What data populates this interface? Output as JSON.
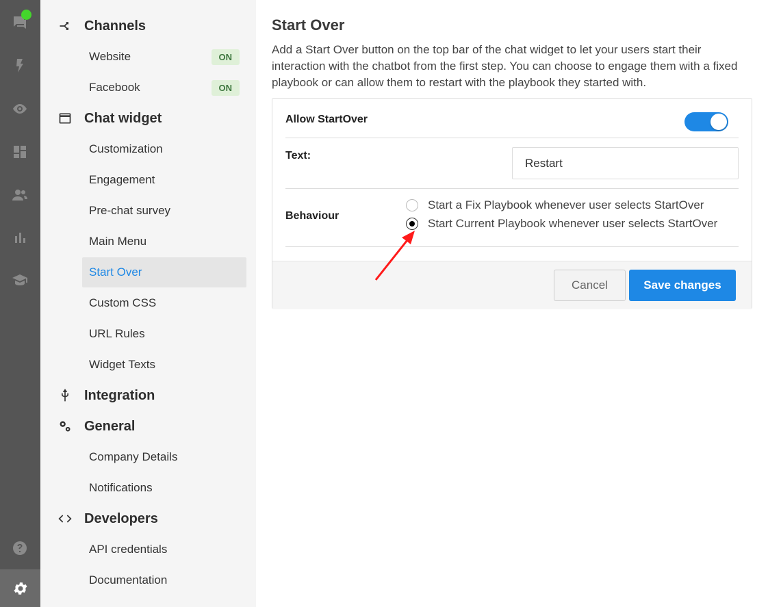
{
  "rail": {
    "icons": [
      "chat-icon",
      "bolt-icon",
      "eye-icon",
      "dashboard-icon",
      "users-icon",
      "bar-chart-icon",
      "graduation-icon",
      "help-icon",
      "gear-icon"
    ],
    "notification_color": "#44d62c"
  },
  "nav": {
    "channels": {
      "title": "Channels",
      "items": [
        {
          "label": "Website",
          "badge": "ON"
        },
        {
          "label": "Facebook",
          "badge": "ON"
        }
      ]
    },
    "chat_widget": {
      "title": "Chat widget",
      "items": [
        "Customization",
        "Engagement",
        "Pre-chat survey",
        "Main Menu",
        "Start Over",
        "Custom CSS",
        "URL Rules",
        "Widget Texts"
      ],
      "active": "Start Over"
    },
    "integration": {
      "title": "Integration"
    },
    "general": {
      "title": "General",
      "items": [
        "Company Details",
        "Notifications"
      ]
    },
    "developers": {
      "title": "Developers",
      "items": [
        "API credentials",
        "Documentation"
      ]
    }
  },
  "main": {
    "title": "Start Over",
    "description": "Add a Start Over button on the top bar of the chat widget to let your users start their interaction with the chatbot from the first step. You can choose to engage them with a fixed playbook or can allow them to restart with the playbook they started with.",
    "allow_label": "Allow StartOver",
    "allow_enabled": true,
    "text_label": "Text:",
    "text_value": "Restart",
    "behaviour_label": "Behaviour",
    "options": [
      {
        "label": "Start a Fix Playbook whenever user selects StartOver",
        "checked": false
      },
      {
        "label": "Start Current Playbook whenever user selects StartOver",
        "checked": true
      }
    ],
    "cancel_label": "Cancel",
    "save_label": "Save changes"
  },
  "colors": {
    "accent": "#1e88e5",
    "annotation": "#ff1a1a"
  }
}
